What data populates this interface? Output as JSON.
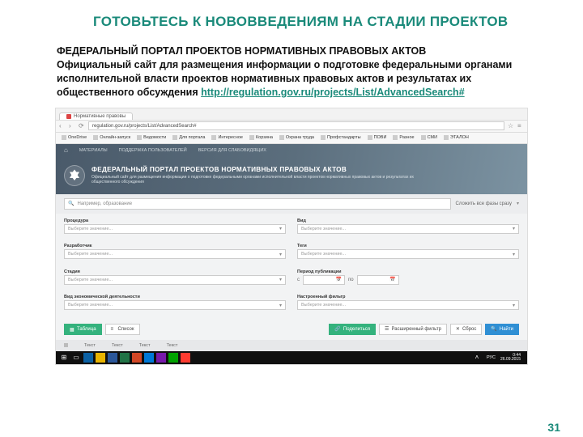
{
  "slide": {
    "title": "ГОТОВЬТЕСЬ К НОВОВВЕДЕНИЯМ НА СТАДИИ ПРОЕКТОВ",
    "intro_bold1": "ФЕДЕРАЛЬНЫЙ ПОРТАЛ ПРОЕКТОВ НОРМАТИВНЫХ ПРАВОВЫХ АКТОВ",
    "intro_rest": "Официальный сайт для размещения информации о подготовке федеральными органами исполнительной власти проектов нормативных правовых актов и результатах их общественного обсуждения ",
    "url_text": "http://regulation.gov.ru/projects/List/AdvancedSearch#",
    "page_number": "31"
  },
  "browser": {
    "tab_title": "Нормативные правовы",
    "address": "regulation.gov.ru/projects/List/AdvancedSearch#",
    "bookmarks": [
      "OneDrive",
      "Онлайн-запуск",
      "Ведомости",
      "Для портала",
      "Интересное",
      "Корзина",
      "Охрана труда",
      "Профстандарты",
      "ПОВИ",
      "Разное",
      "СМИ",
      "ЭТАЛОН"
    ]
  },
  "page": {
    "topnav": [
      "МАТЕРИАЛЫ",
      "ПОДДЕРЖКА ПОЛЬЗОВАТЕЛЕЙ",
      "ВЕРСИЯ ДЛЯ СЛАБОВИДЯЩИХ"
    ],
    "hero_title": "ФЕДЕРАЛЬНЫЙ ПОРТАЛ ПРОЕКТОВ НОРМАТИВНЫХ ПРАВОВЫХ АКТОВ",
    "hero_sub": "Официальный сайт для размещения информации о подготовке федеральными органами исполнительной власти проектов нормативных правовых актов и результатах их общественного обсуждения",
    "search_placeholder": "Например, образование",
    "collapse": "Сложить все фазы сразу",
    "fields": {
      "procedure": "Процедура",
      "developer": "Разработчик",
      "stage": "Стадия",
      "okved": "Вид экономической деятельности",
      "kind": "Вид",
      "tags": "Теги",
      "period": "Период публикации",
      "saved_filter": "Настроенный фильтр",
      "placeholder": "Выберите значение..."
    },
    "date_labels": {
      "from": "с",
      "to": "по"
    },
    "view_tabs": {
      "table": "Таблица",
      "list": "Список"
    },
    "action_buttons": {
      "share": "Поделиться",
      "advanced": "Расширенный фильтр",
      "reset": "Сброс",
      "find": "Найти"
    },
    "result_cols": [
      "",
      "",
      "",
      "Текст",
      "",
      "Текст",
      "",
      "Текст",
      "",
      "Текст"
    ]
  },
  "taskbar": {
    "time": "0:44",
    "date": "26.09.2015",
    "lang": "РУС"
  }
}
